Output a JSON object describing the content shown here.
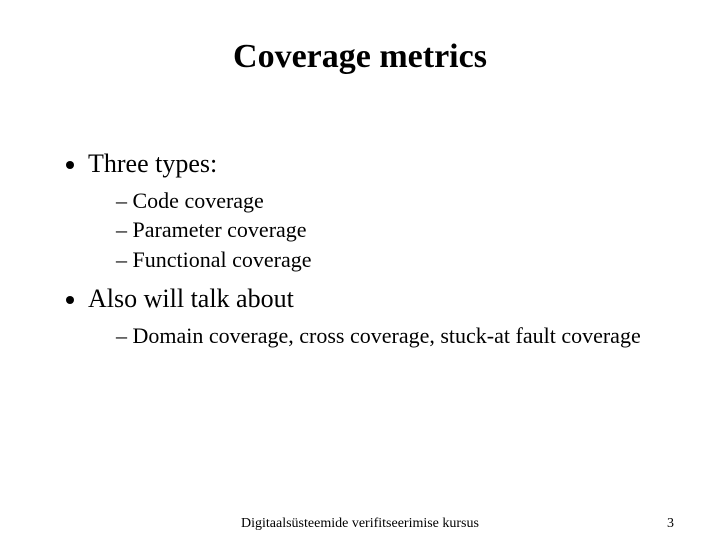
{
  "title": "Coverage metrics",
  "bullets": {
    "item1": {
      "label": "Three types:",
      "sub": {
        "a": "Code coverage",
        "b": "Parameter coverage",
        "c": "Functional coverage"
      }
    },
    "item2": {
      "label": "Also will talk about",
      "sub": {
        "a": "Domain coverage, cross coverage, stuck-at fault coverage"
      }
    }
  },
  "footer": {
    "center": "Digitaalsüsteemide verifitseerimise kursus",
    "page_number": "3"
  }
}
